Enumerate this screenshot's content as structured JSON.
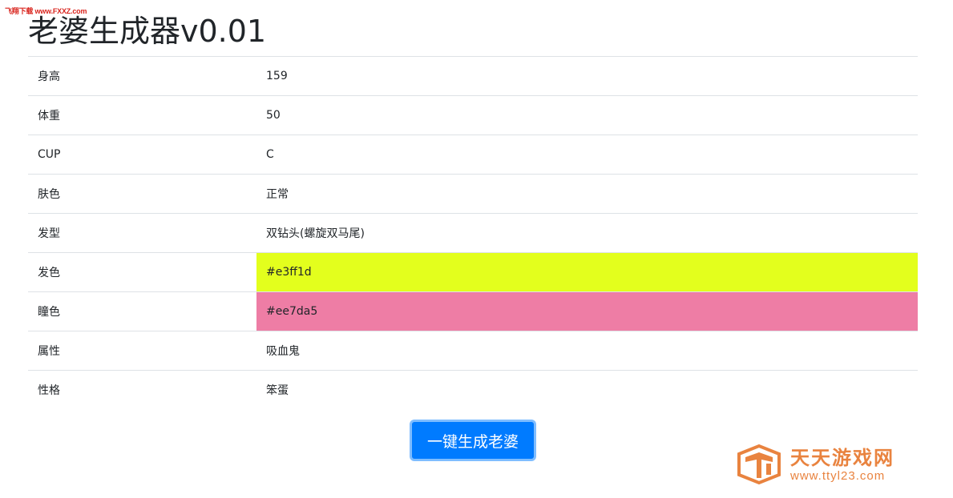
{
  "watermark_top": "飞翔下载 www.FXXZ.com",
  "title": "老婆生成器v0.01",
  "rows": [
    {
      "label": "身高",
      "value": "159",
      "bg": ""
    },
    {
      "label": "体重",
      "value": "50",
      "bg": ""
    },
    {
      "label": "CUP",
      "value": "C",
      "bg": ""
    },
    {
      "label": "肤色",
      "value": "正常",
      "bg": ""
    },
    {
      "label": "发型",
      "value": "双钻头(螺旋双马尾)",
      "bg": ""
    },
    {
      "label": "发色",
      "value": "#e3ff1d",
      "bg": "#e3ff1d"
    },
    {
      "label": "瞳色",
      "value": "#ee7da5",
      "bg": "#ee7da5"
    },
    {
      "label": "属性",
      "value": "吸血鬼",
      "bg": ""
    },
    {
      "label": "性格",
      "value": "笨蛋",
      "bg": ""
    }
  ],
  "button": {
    "label": "一键生成老婆"
  },
  "site_logo": {
    "name": "天天游戏网",
    "url": "www.ttyl23.com",
    "color": "#e9833f",
    "icon": "tt-logo-icon"
  },
  "colors": {
    "primary": "#007bff",
    "border": "#dee2e6",
    "text": "#212529"
  }
}
